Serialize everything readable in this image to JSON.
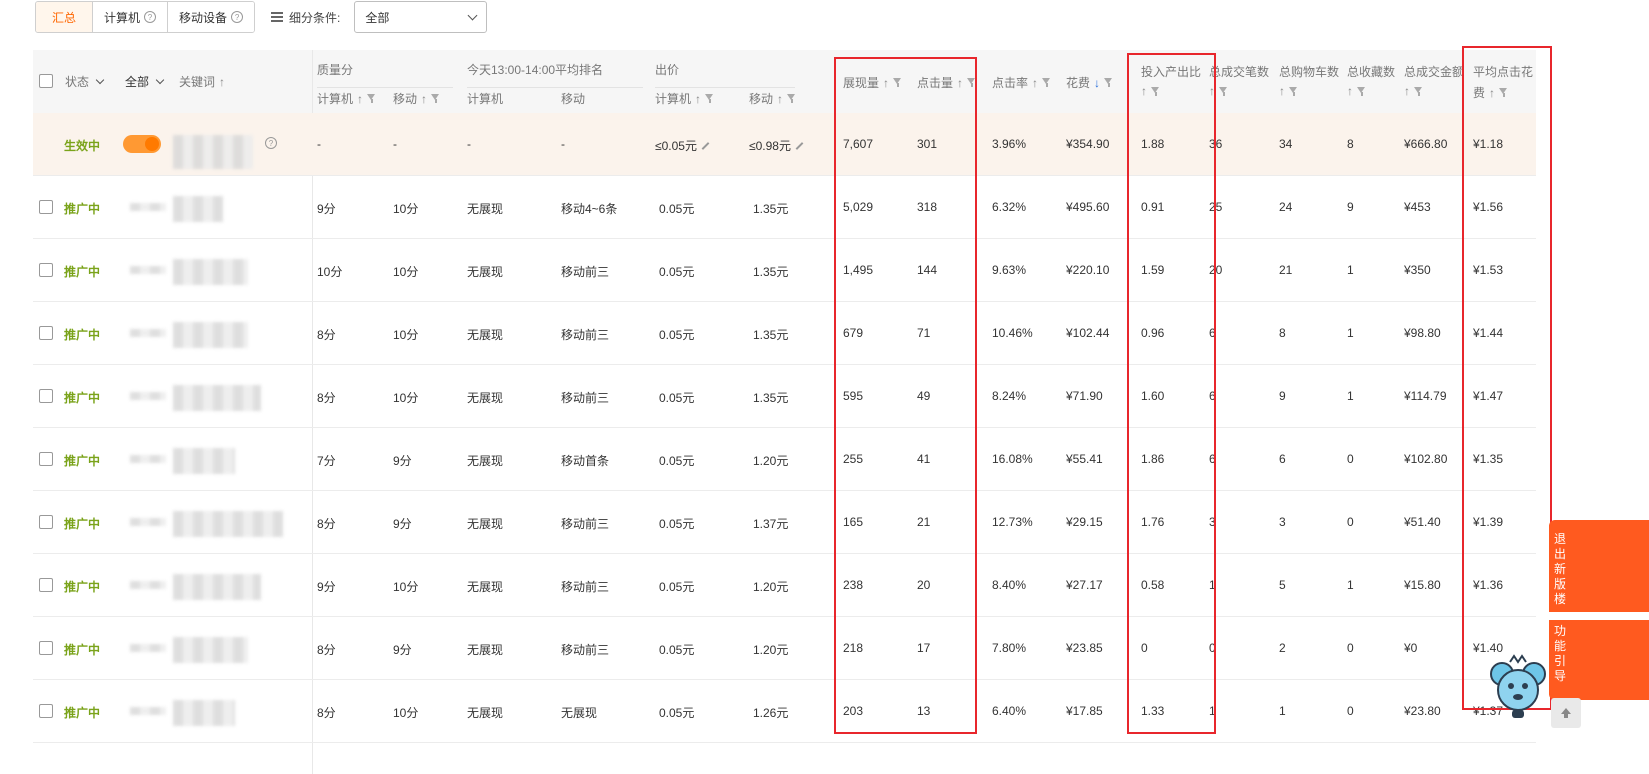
{
  "toolbar": {
    "tabs": [
      {
        "label": "汇总",
        "active": true,
        "help": false
      },
      {
        "label": "计算机",
        "active": false,
        "help": true
      },
      {
        "label": "移动设备",
        "active": false,
        "help": true
      }
    ],
    "filter_label": "细分条件:",
    "filter_value": "全部"
  },
  "header": {
    "status": "状态",
    "all": "全部",
    "keyword": "关键词",
    "quality": "质量分",
    "quality_pc": "计算机",
    "quality_mobile": "移动",
    "rank": "今天13:00-14:00平均排名",
    "rank_pc": "计算机",
    "rank_mobile": "移动",
    "bid": "出价",
    "bid_pc": "计算机",
    "bid_mobile": "移动",
    "impressions": "展现量",
    "clicks": "点击量",
    "ctr": "点击率",
    "cost": "花费",
    "roi": "投入产出比",
    "deals": "总成交笔数",
    "carts": "总购物车数",
    "favs": "总收藏数",
    "gmv": "总成交金额",
    "cpc_line1": "平均点击花",
    "cpc_line2": "费"
  },
  "summary": {
    "status": "生效中",
    "quality_pc": "-",
    "quality_mobile": "-",
    "rank_pc": "-",
    "rank_mobile": "-",
    "bid_pc": "≤0.05元",
    "bid_mobile": "≤0.98元",
    "impressions": "7,607",
    "clicks": "301",
    "ctr": "3.96%",
    "cost": "¥354.90",
    "roi": "1.88",
    "deals": "36",
    "carts": "34",
    "favs": "8",
    "gmv": "¥666.80",
    "cpc": "¥1.18"
  },
  "rows": [
    {
      "status": "推广中",
      "quality_pc": "9分",
      "quality_mobile": "10分",
      "rank_pc": "无展现",
      "rank_mobile": "移动4~6条",
      "bid_pc": "0.05元",
      "bid_mobile": "1.35元",
      "impressions": "5,029",
      "clicks": "318",
      "ctr": "6.32%",
      "cost": "¥495.60",
      "roi": "0.91",
      "deals": "25",
      "carts": "24",
      "favs": "9",
      "gmv": "¥453",
      "cpc": "¥1.56"
    },
    {
      "status": "推广中",
      "quality_pc": "10分",
      "quality_mobile": "10分",
      "rank_pc": "无展现",
      "rank_mobile": "移动前三",
      "bid_pc": "0.05元",
      "bid_mobile": "1.35元",
      "impressions": "1,495",
      "clicks": "144",
      "ctr": "9.63%",
      "cost": "¥220.10",
      "roi": "1.59",
      "deals": "20",
      "carts": "21",
      "favs": "1",
      "gmv": "¥350",
      "cpc": "¥1.53"
    },
    {
      "status": "推广中",
      "quality_pc": "8分",
      "quality_mobile": "10分",
      "rank_pc": "无展现",
      "rank_mobile": "移动前三",
      "bid_pc": "0.05元",
      "bid_mobile": "1.35元",
      "impressions": "679",
      "clicks": "71",
      "ctr": "10.46%",
      "cost": "¥102.44",
      "roi": "0.96",
      "deals": "6",
      "carts": "8",
      "favs": "1",
      "gmv": "¥98.80",
      "cpc": "¥1.44"
    },
    {
      "status": "推广中",
      "quality_pc": "8分",
      "quality_mobile": "10分",
      "rank_pc": "无展现",
      "rank_mobile": "移动前三",
      "bid_pc": "0.05元",
      "bid_mobile": "1.35元",
      "impressions": "595",
      "clicks": "49",
      "ctr": "8.24%",
      "cost": "¥71.90",
      "roi": "1.60",
      "deals": "6",
      "carts": "9",
      "favs": "1",
      "gmv": "¥114.79",
      "cpc": "¥1.47"
    },
    {
      "status": "推广中",
      "quality_pc": "7分",
      "quality_mobile": "9分",
      "rank_pc": "无展现",
      "rank_mobile": "移动首条",
      "bid_pc": "0.05元",
      "bid_mobile": "1.20元",
      "impressions": "255",
      "clicks": "41",
      "ctr": "16.08%",
      "cost": "¥55.41",
      "roi": "1.86",
      "deals": "6",
      "carts": "6",
      "favs": "0",
      "gmv": "¥102.80",
      "cpc": "¥1.35"
    },
    {
      "status": "推广中",
      "quality_pc": "8分",
      "quality_mobile": "9分",
      "rank_pc": "无展现",
      "rank_mobile": "移动前三",
      "bid_pc": "0.05元",
      "bid_mobile": "1.37元",
      "impressions": "165",
      "clicks": "21",
      "ctr": "12.73%",
      "cost": "¥29.15",
      "roi": "1.76",
      "deals": "3",
      "carts": "3",
      "favs": "0",
      "gmv": "¥51.40",
      "cpc": "¥1.39"
    },
    {
      "status": "推广中",
      "quality_pc": "9分",
      "quality_mobile": "10分",
      "rank_pc": "无展现",
      "rank_mobile": "移动前三",
      "bid_pc": "0.05元",
      "bid_mobile": "1.20元",
      "impressions": "238",
      "clicks": "20",
      "ctr": "8.40%",
      "cost": "¥27.17",
      "roi": "0.58",
      "deals": "1",
      "carts": "5",
      "favs": "1",
      "gmv": "¥15.80",
      "cpc": "¥1.36"
    },
    {
      "status": "推广中",
      "quality_pc": "8分",
      "quality_mobile": "9分",
      "rank_pc": "无展现",
      "rank_mobile": "移动前三",
      "bid_pc": "0.05元",
      "bid_mobile": "1.20元",
      "impressions": "218",
      "clicks": "17",
      "ctr": "7.80%",
      "cost": "¥23.85",
      "roi": "0",
      "deals": "0",
      "carts": "2",
      "favs": "0",
      "gmv": "¥0",
      "cpc": "¥1.40"
    },
    {
      "status": "推广中",
      "quality_pc": "8分",
      "quality_mobile": "10分",
      "rank_pc": "无展现",
      "rank_mobile": "无展现",
      "bid_pc": "0.05元",
      "bid_mobile": "1.26元",
      "impressions": "203",
      "clicks": "13",
      "ctr": "6.40%",
      "cost": "¥17.85",
      "roi": "1.33",
      "deals": "1",
      "carts": "1",
      "favs": "0",
      "gmv": "¥23.80",
      "cpc": "¥1.37"
    }
  ],
  "side_float": {
    "items": [
      "退出新版楼",
      "功能引导"
    ]
  },
  "colors": {
    "accent": "#ff6600",
    "status_green": "#7aa31a",
    "highlight_red": "#e8262c",
    "summary_bg": "#fbf3ec"
  },
  "icons": [
    "help-icon",
    "list-icon",
    "chevron-down-icon",
    "sort-up-icon",
    "sort-down-icon",
    "filter-icon",
    "edit-icon",
    "toggle-switch",
    "mascot-icon",
    "scroll-top-icon"
  ]
}
